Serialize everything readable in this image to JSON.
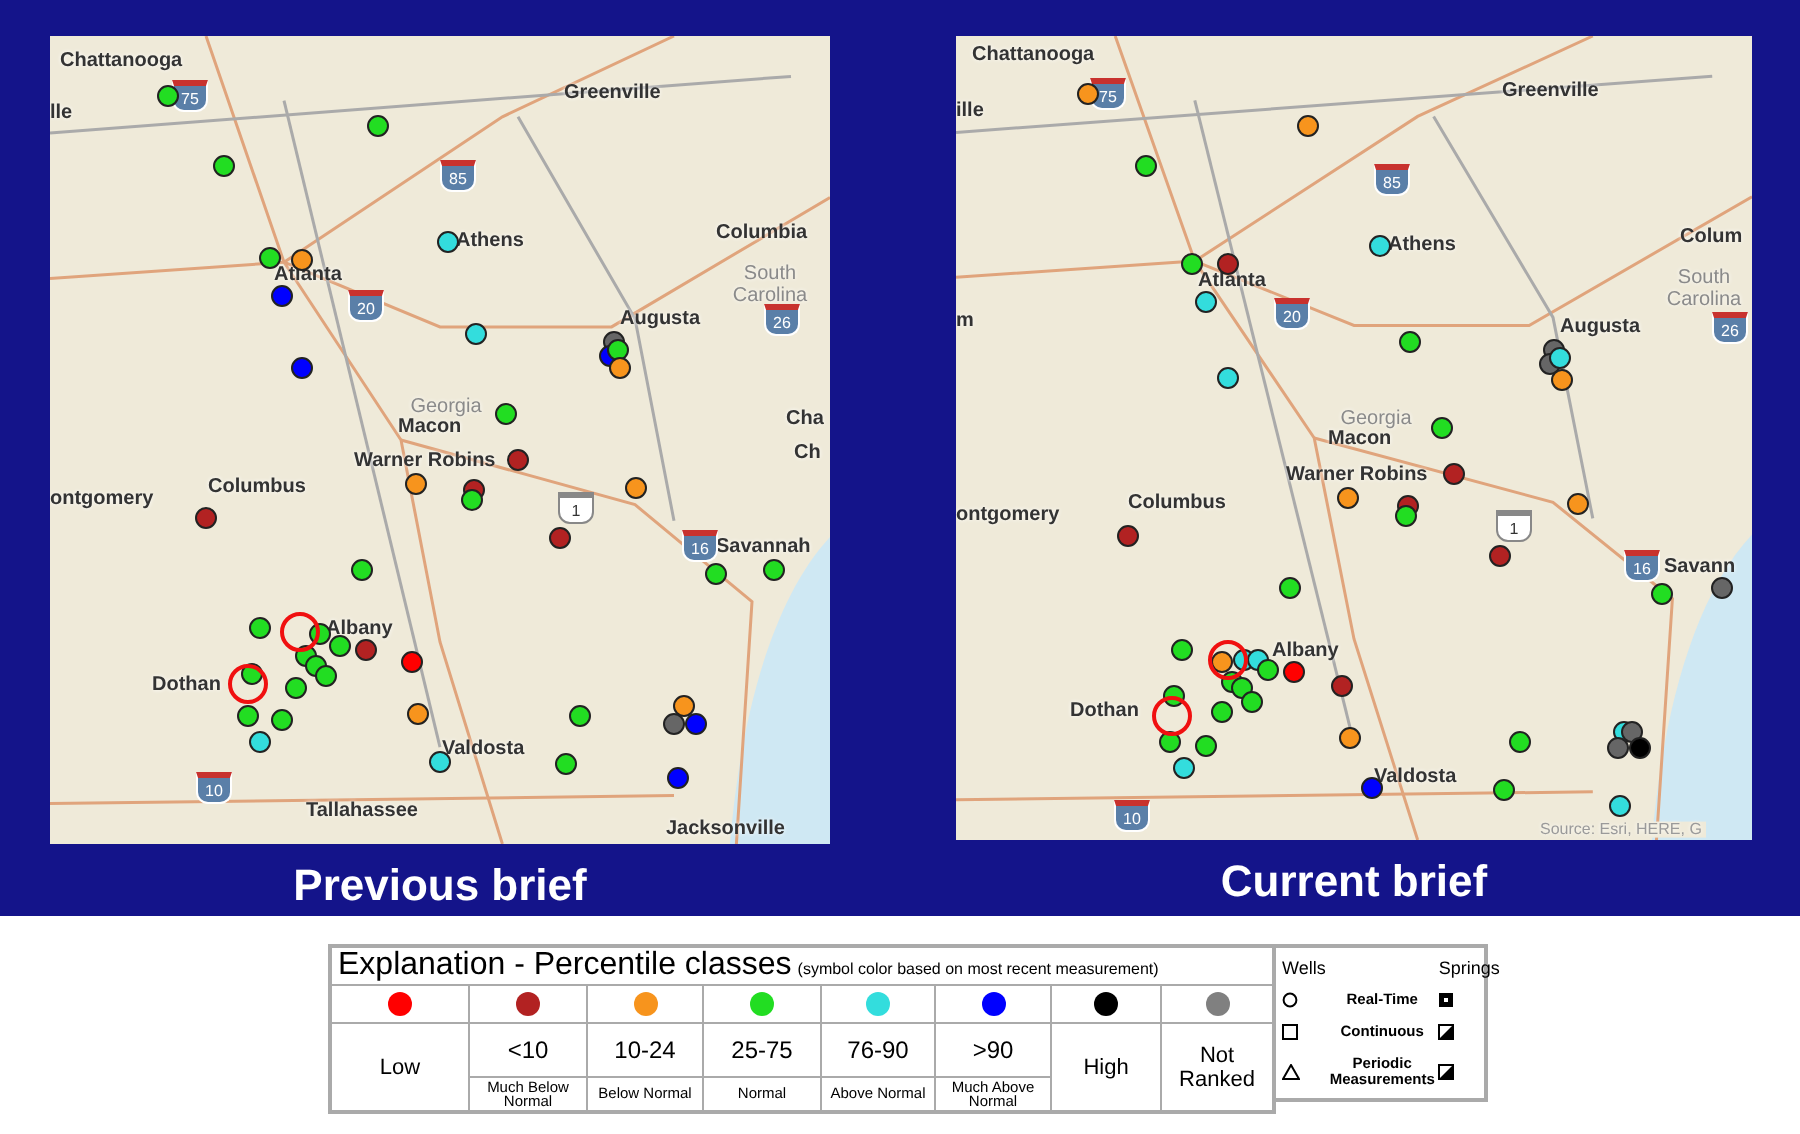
{
  "maps": [
    {
      "caption": "Previous brief",
      "places": [
        {
          "kind": "city",
          "name": "Chattanooga"
        },
        {
          "kind": "city",
          "name": "lle"
        },
        {
          "kind": "city",
          "name": "Greenville"
        },
        {
          "kind": "city",
          "name": "Athens"
        },
        {
          "kind": "city",
          "name": "Columbia"
        },
        {
          "kind": "city",
          "name": "Atlanta"
        },
        {
          "kind": "region",
          "name": "South Carolina"
        },
        {
          "kind": "city",
          "name": "Augusta"
        },
        {
          "kind": "region",
          "name": "Georgia"
        },
        {
          "kind": "city",
          "name": "Macon"
        },
        {
          "kind": "city",
          "name": "Cha"
        },
        {
          "kind": "city",
          "name": "Ch"
        },
        {
          "kind": "city",
          "name": "Warner Robins"
        },
        {
          "kind": "city",
          "name": "Columbus"
        },
        {
          "kind": "city",
          "name": "ontgomery"
        },
        {
          "kind": "city",
          "name": "Savannah"
        },
        {
          "kind": "city",
          "name": "Albany"
        },
        {
          "kind": "city",
          "name": "Dothan"
        },
        {
          "kind": "city",
          "name": "Valdosta"
        },
        {
          "kind": "city",
          "name": "Tallahassee"
        },
        {
          "kind": "city",
          "name": "Jacksonville"
        }
      ],
      "shields": [
        {
          "kind": "interstate",
          "number": "75"
        },
        {
          "kind": "interstate",
          "number": "85"
        },
        {
          "kind": "interstate",
          "number": "20"
        },
        {
          "kind": "interstate",
          "number": "26"
        },
        {
          "kind": "us",
          "number": "1"
        },
        {
          "kind": "interstate",
          "number": "16"
        },
        {
          "kind": "interstate",
          "number": "10"
        }
      ],
      "sites": [
        {
          "color": "#22dd22"
        },
        {
          "color": "#22dd22"
        },
        {
          "color": "#22dd22"
        },
        {
          "color": "#22dd22"
        },
        {
          "color": "#f7941d"
        },
        {
          "color": "#0000ff"
        },
        {
          "color": "#33dddd"
        },
        {
          "color": "#33dddd"
        },
        {
          "color": "#0000ff"
        },
        {
          "color": "#22dd22"
        },
        {
          "color": "#666666"
        },
        {
          "color": "#0000ff"
        },
        {
          "color": "#22dd22"
        },
        {
          "color": "#f7941d"
        },
        {
          "color": "#b22222"
        },
        {
          "color": "#f7941d"
        },
        {
          "color": "#b22222"
        },
        {
          "color": "#22dd22"
        },
        {
          "color": "#f7941d"
        },
        {
          "color": "#b22222"
        },
        {
          "color": "#b22222"
        },
        {
          "color": "#22dd22"
        },
        {
          "color": "#22dd22"
        },
        {
          "color": "#22dd22"
        },
        {
          "color": "#22dd22"
        },
        {
          "color": "#22dd22"
        },
        {
          "color": "#22dd22"
        },
        {
          "color": "#b22222"
        },
        {
          "color": "#22dd22"
        },
        {
          "color": "#22dd22"
        },
        {
          "color": "#22dd22"
        },
        {
          "color": "#ff0000"
        },
        {
          "color": "#22dd22"
        },
        {
          "color": "#22dd22"
        },
        {
          "color": "#22dd22"
        },
        {
          "color": "#22dd22"
        },
        {
          "color": "#33dddd"
        },
        {
          "color": "#f7941d"
        },
        {
          "color": "#22dd22"
        },
        {
          "color": "#22dd22"
        },
        {
          "color": "#33dddd"
        },
        {
          "color": "#f7941d"
        },
        {
          "color": "#666666"
        },
        {
          "color": "#0000ff"
        },
        {
          "color": "#0000ff"
        }
      ]
    },
    {
      "caption": "Current brief",
      "places": [
        {
          "kind": "city",
          "name": "Chattanooga"
        },
        {
          "kind": "city",
          "name": "ille"
        },
        {
          "kind": "city",
          "name": "Greenville"
        },
        {
          "kind": "city",
          "name": "Athens"
        },
        {
          "kind": "city",
          "name": "Colum"
        },
        {
          "kind": "city",
          "name": "Atlanta"
        },
        {
          "kind": "region",
          "name": "South Carolina"
        },
        {
          "kind": "city",
          "name": "Augusta"
        },
        {
          "kind": "region",
          "name": "Georgia"
        },
        {
          "kind": "city",
          "name": "Macon"
        },
        {
          "kind": "city",
          "name": "m"
        },
        {
          "kind": "city",
          "name": "Warner Robins"
        },
        {
          "kind": "city",
          "name": "Columbus"
        },
        {
          "kind": "city",
          "name": "ontgomery"
        },
        {
          "kind": "city",
          "name": "Savann"
        },
        {
          "kind": "city",
          "name": "Albany"
        },
        {
          "kind": "city",
          "name": "Dothan"
        },
        {
          "kind": "city",
          "name": "Valdosta"
        },
        {
          "kind": "credit",
          "name": "Source: Esri, HERE, G"
        }
      ],
      "shields": [
        {
          "kind": "interstate",
          "number": "75"
        },
        {
          "kind": "interstate",
          "number": "85"
        },
        {
          "kind": "interstate",
          "number": "20"
        },
        {
          "kind": "interstate",
          "number": "26"
        },
        {
          "kind": "us",
          "number": "1"
        },
        {
          "kind": "interstate",
          "number": "16"
        },
        {
          "kind": "interstate",
          "number": "10"
        }
      ],
      "sites": [
        {
          "color": "#f7941d"
        },
        {
          "color": "#f7941d"
        },
        {
          "color": "#22dd22"
        },
        {
          "color": "#22dd22"
        },
        {
          "color": "#b22222"
        },
        {
          "color": "#33dddd"
        },
        {
          "color": "#33dddd"
        },
        {
          "color": "#33dddd"
        },
        {
          "color": "#22dd22"
        },
        {
          "color": "#22dd22"
        },
        {
          "color": "#666666"
        },
        {
          "color": "#666666"
        },
        {
          "color": "#33dddd"
        },
        {
          "color": "#f7941d"
        },
        {
          "color": "#b22222"
        },
        {
          "color": "#f7941d"
        },
        {
          "color": "#b22222"
        },
        {
          "color": "#22dd22"
        },
        {
          "color": "#f7941d"
        },
        {
          "color": "#b22222"
        },
        {
          "color": "#b22222"
        },
        {
          "color": "#22dd22"
        },
        {
          "color": "#22dd22"
        },
        {
          "color": "#666666"
        },
        {
          "color": "#22dd22"
        },
        {
          "color": "#f7941d"
        },
        {
          "color": "#33dddd"
        },
        {
          "color": "#33dddd"
        },
        {
          "color": "#22dd22"
        },
        {
          "color": "#ff0000"
        },
        {
          "color": "#22dd22"
        },
        {
          "color": "#22dd22"
        },
        {
          "color": "#22dd22"
        },
        {
          "color": "#b22222"
        },
        {
          "color": "#22dd22"
        },
        {
          "color": "#22dd22"
        },
        {
          "color": "#22dd22"
        },
        {
          "color": "#22dd22"
        },
        {
          "color": "#33dddd"
        },
        {
          "color": "#f7941d"
        },
        {
          "color": "#0000ff"
        },
        {
          "color": "#22dd22"
        },
        {
          "color": "#22dd22"
        },
        {
          "color": "#33dddd"
        },
        {
          "color": "#666666"
        },
        {
          "color": "#666666"
        },
        {
          "color": "#000000"
        },
        {
          "color": "#33dddd"
        }
      ]
    }
  ],
  "legend": {
    "title": "Explanation - Percentile classes",
    "note": "(symbol color based on most recent measurement)",
    "classes": [
      {
        "kind": "single",
        "color": "#ff0000",
        "label": "Low"
      },
      {
        "kind": "range",
        "color": "#b22222",
        "range": "<10",
        "label": "Much Below Normal"
      },
      {
        "kind": "range",
        "color": "#f7941d",
        "range": "10-24",
        "label": "Below Normal"
      },
      {
        "kind": "range",
        "color": "#22dd22",
        "range": "25-75",
        "label": "Normal"
      },
      {
        "kind": "range",
        "color": "#33dddd",
        "range": "76-90",
        "label": "Above Normal"
      },
      {
        "kind": "range",
        "color": "#0000ff",
        "range": ">90",
        "label": "Much Above Normal"
      },
      {
        "kind": "single",
        "color": "#000000",
        "label": "High"
      },
      {
        "kind": "single",
        "color": "#808080",
        "label": "Not Ranked"
      }
    ],
    "symbols": {
      "wells": "Wells",
      "springs": "Springs",
      "rows": [
        {
          "kind": "circle",
          "label": "Real-Time"
        },
        {
          "kind": "square",
          "label": "Continuous"
        },
        {
          "kind": "triangle",
          "label": "Periodic Measurements"
        }
      ]
    }
  }
}
